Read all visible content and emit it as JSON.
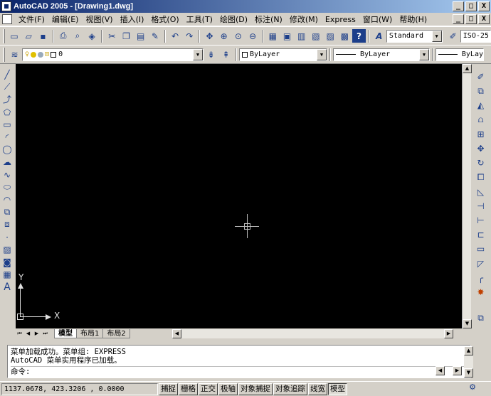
{
  "window": {
    "title": "AutoCAD 2005 - [Drawing1.dwg]",
    "minimize": "_",
    "restore": "□",
    "close": "X"
  },
  "menu": [
    "文件(F)",
    "编辑(E)",
    "视图(V)",
    "插入(I)",
    "格式(O)",
    "工具(T)",
    "绘图(D)",
    "标注(N)",
    "修改(M)",
    "Express",
    "窗口(W)",
    "帮助(H)"
  ],
  "standard_toolbar": {
    "text_style": "Standard",
    "dim_style": "ISO-25"
  },
  "layers_toolbar": {
    "layer_name": "0",
    "color": "ByLayer",
    "linetype": "ByLayer",
    "lineweight": "ByLay"
  },
  "canvas": {
    "ucs_x_label": "X",
    "ucs_y_label": "Y"
  },
  "tabs": [
    {
      "label": "模型",
      "active": true
    },
    {
      "label": "布局1",
      "active": false
    },
    {
      "label": "布局2",
      "active": false
    }
  ],
  "command": {
    "lines": [
      "菜单加载成功。菜单组: EXPRESS",
      "AutoCAD 菜单实用程序已加载。",
      "命令:"
    ]
  },
  "status": {
    "coordinates": "1137.0678, 423.3206 , 0.0000",
    "buttons": [
      {
        "label": "捕捉",
        "pressed": false
      },
      {
        "label": "栅格",
        "pressed": false
      },
      {
        "label": "正交",
        "pressed": false
      },
      {
        "label": "极轴",
        "pressed": false
      },
      {
        "label": "对象捕捉",
        "pressed": false
      },
      {
        "label": "对象追踪",
        "pressed": false
      },
      {
        "label": "线宽",
        "pressed": false
      },
      {
        "label": "模型",
        "pressed": true
      }
    ]
  },
  "colors": {
    "title_start": "#0a246a",
    "title_end": "#a6caf0",
    "canvas_bg": "#000000",
    "chrome": "#d4d0c8"
  }
}
